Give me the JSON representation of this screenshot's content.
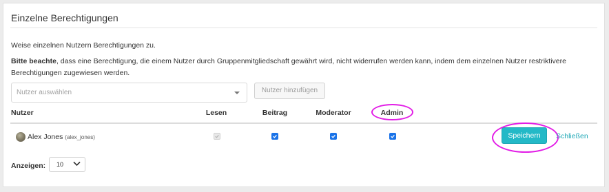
{
  "panel": {
    "title": "Einzelne Berechtigungen",
    "intro": "Weise einzelnen Nutzern Berechtigungen zu.",
    "notice_bold": "Bitte beachte",
    "notice_text": ", dass eine Berechtigung, die einem Nutzer durch Gruppenmitgliedschaft gewährt wird, nicht widerrufen werden kann, indem dem einzelnen Nutzer restriktivere Berechtigungen zugewiesen werden."
  },
  "user_select": {
    "placeholder": "Nutzer auswählen"
  },
  "add_user_button": "Nutzer hinzufügen",
  "table": {
    "headers": {
      "user": "Nutzer",
      "read": "Lesen",
      "post": "Beitrag",
      "moderator": "Moderator",
      "admin": "Admin"
    },
    "rows": [
      {
        "name": "Alex Jones",
        "handle": "(alex_jones)",
        "read": true,
        "read_disabled": true,
        "post": true,
        "moderator": true,
        "admin": true,
        "save_label": "Speichern",
        "close_label": "Schließen"
      }
    ]
  },
  "pagination": {
    "label": "Anzeigen:",
    "value": "10"
  },
  "colors": {
    "accent": "#23b9c7",
    "link": "#1fa8b6",
    "highlight": "#e21ce6",
    "checkbox": "#1a73e8"
  }
}
